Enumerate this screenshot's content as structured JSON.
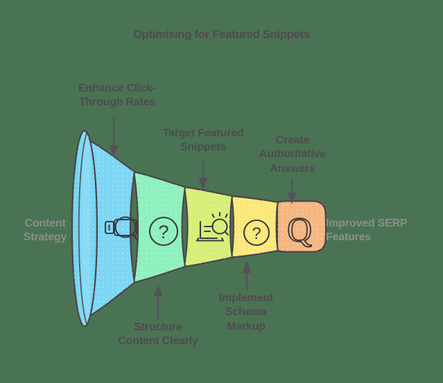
{
  "title": "Optimising for Featured Snippets",
  "colors": {
    "background": "#4a7353",
    "text_dark": "#4f4b52",
    "text_muted": "#8d8d8d",
    "outline": "#4a4449",
    "stage1": "#7dd6f4",
    "stage1_dark": "#5fc8ee",
    "stage2": "#8ef0bd",
    "stage3": "#d7ee78",
    "stage4": "#fae97a",
    "stage5": "#f5b781"
  },
  "endpoints": {
    "input": "Content\nStrategy",
    "output": "Improved SERP\nFeatures"
  },
  "stages": [
    {
      "id": "stage-1",
      "icon": "snippet-search-icon",
      "color": "#7dd6f4",
      "label": "Enhance Click-\nThrough Rates",
      "label_position": "top"
    },
    {
      "id": "stage-2",
      "icon": "question-mark-circle-icon",
      "color": "#8ef0bd",
      "label": "Structure\nContent Clearly",
      "label_position": "bottom"
    },
    {
      "id": "stage-3",
      "icon": "laptop-search-icon",
      "color": "#d7ee78",
      "label": "Target Featured\nSnippets",
      "label_position": "top"
    },
    {
      "id": "stage-4",
      "icon": "question-mark-circle-icon",
      "color": "#fae97a",
      "label": "Implement\nSchema\nMarkup",
      "label_position": "bottom"
    },
    {
      "id": "stage-5",
      "icon": "letter-q-icon",
      "color": "#f5b781",
      "label": "Create\nAuthoritative\nAnswers",
      "label_position": "top"
    }
  ]
}
